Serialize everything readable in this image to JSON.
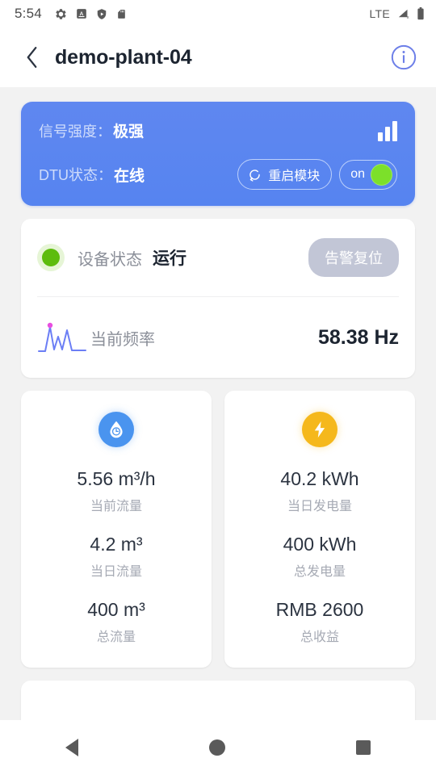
{
  "statusbar": {
    "time": "5:54",
    "network": "LTE",
    "icons": [
      "gear-icon",
      "app-badge-icon",
      "shield-play-icon",
      "sd-card-icon"
    ],
    "right_icons": [
      "signal-bars-off-icon",
      "battery-icon"
    ]
  },
  "header": {
    "back_icon": "chevron-left-icon",
    "title": "demo-plant-04",
    "info_icon": "info-circle-icon"
  },
  "signal_card": {
    "signal_label": "信号强度：",
    "signal_value": "极强",
    "dtu_label": "DTU状态：",
    "dtu_value": "在线",
    "restart_label": "重启模块",
    "restart_icon": "refresh-circle-icon",
    "toggle_label": "on",
    "toggle_state": "on",
    "bars_icon": "signal-bars-icon",
    "bg_color": "#5a84f0",
    "toggle_knob_color": "#7ce02a"
  },
  "status_card": {
    "status_label": "设备状态",
    "status_value": "运行",
    "status_dot_color": "#5dbc0d",
    "alarm_reset_label": "告警复位",
    "alarm_reset_color": "#c2c6d6",
    "freq_icon": "waveform-icon",
    "freq_label": "当前频率",
    "freq_value": "58.38 Hz"
  },
  "metric_cards": [
    {
      "icon": "water-drop-icon",
      "icon_color": "#4a94ef",
      "rows": [
        {
          "value": "5.56 m³/h",
          "label": "当前流量"
        },
        {
          "value": "4.2 m³",
          "label": "当日流量"
        },
        {
          "value": "400 m³",
          "label": "总流量"
        }
      ]
    },
    {
      "icon": "lightning-bolt-icon",
      "icon_color": "#f5b81c",
      "rows": [
        {
          "value": "40.2 kWh",
          "label": "当日发电量"
        },
        {
          "value": "400 kWh",
          "label": "总发电量"
        },
        {
          "value": "RMB 2600",
          "label": "总收益"
        }
      ]
    }
  ],
  "navbar": {
    "back": "nav-back-icon",
    "home": "nav-home-icon",
    "recents": "nav-recents-icon"
  }
}
